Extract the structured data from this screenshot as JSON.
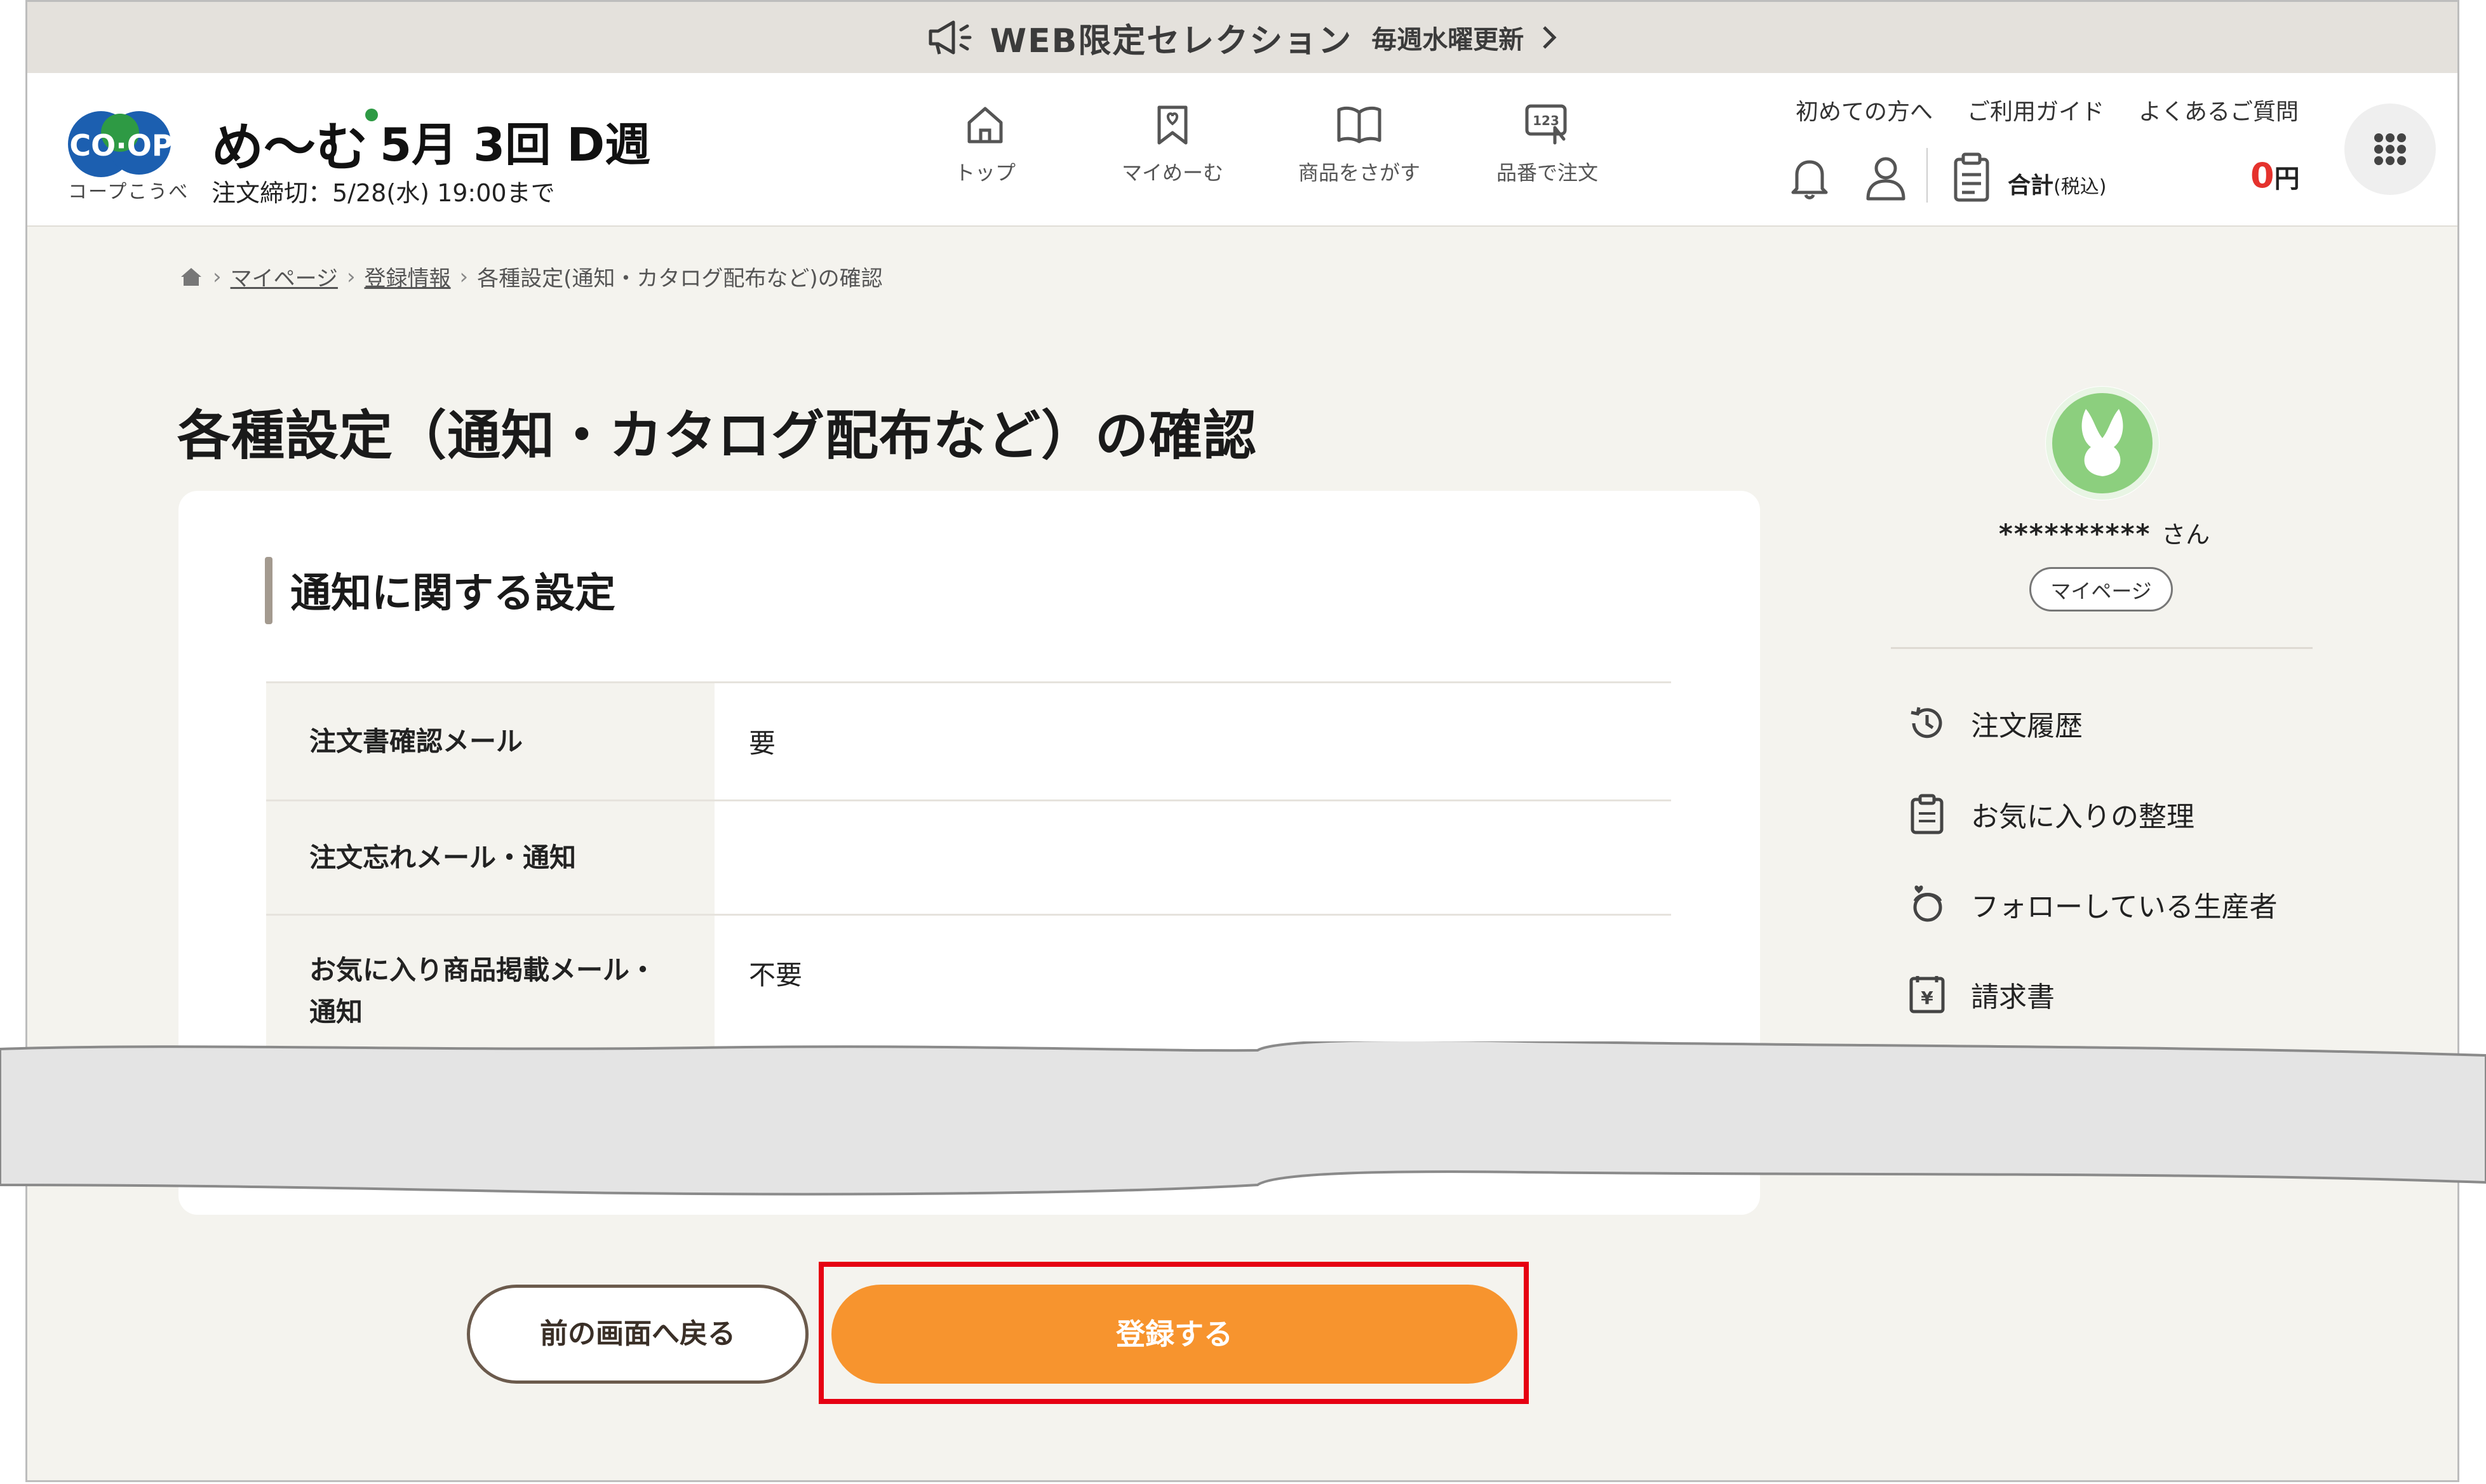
{
  "announcement": {
    "title": "WEB限定セレクション",
    "subtitle": "毎週水曜更新"
  },
  "header": {
    "logo_text": "CO·OP",
    "logo_sub": "コープこうべ",
    "brand": "め〜む",
    "round": "5月 3回 D週",
    "deadline": "注文締切：5/28(水) 19:00まで",
    "nav": [
      {
        "label": "トップ",
        "icon": "home-icon"
      },
      {
        "label": "マイめーむ",
        "icon": "bookmark-heart-icon"
      },
      {
        "label": "商品をさがす",
        "icon": "book-icon"
      },
      {
        "label": "品番で注文",
        "icon": "number-entry-icon"
      }
    ],
    "top_links": [
      "初めての方へ",
      "ご利用ガイド",
      "よくあるご質問"
    ],
    "total_label": "合計",
    "total_tax": "(税込)",
    "total_amount": "0",
    "currency": "円"
  },
  "breadcrumb": {
    "items": [
      "マイページ",
      "登録情報"
    ],
    "current": "各種設定(通知・カタログ配布など)の確認"
  },
  "page_title": "各種設定（通知・カタログ配布など）の確認",
  "section": {
    "title": "通知に関する設定",
    "rows": [
      {
        "label": "注文書確認メール",
        "value": "要"
      },
      {
        "label": "注文忘れメール・通知",
        "value": ""
      },
      {
        "label": "お気に入り商品掲載メール・通知",
        "value": "不要"
      }
    ]
  },
  "sidebar": {
    "username": "**********",
    "honorific": "さん",
    "mypage_label": "マイページ",
    "links": [
      {
        "label": "注文履歴",
        "icon": "history-icon"
      },
      {
        "label": "お気に入りの整理",
        "icon": "favorites-list-icon"
      },
      {
        "label": "フォローしている生産者",
        "icon": "producer-icon"
      },
      {
        "label": "請求書",
        "icon": "invoice-icon"
      }
    ]
  },
  "actions": {
    "back_label": "前の画面へ戻る",
    "register_label": "登録する"
  },
  "colors": {
    "accent_orange": "#f7942e",
    "highlight_red": "#e60012",
    "brand_green": "#2e9a44",
    "logo_blue": "#1c5fb0"
  }
}
